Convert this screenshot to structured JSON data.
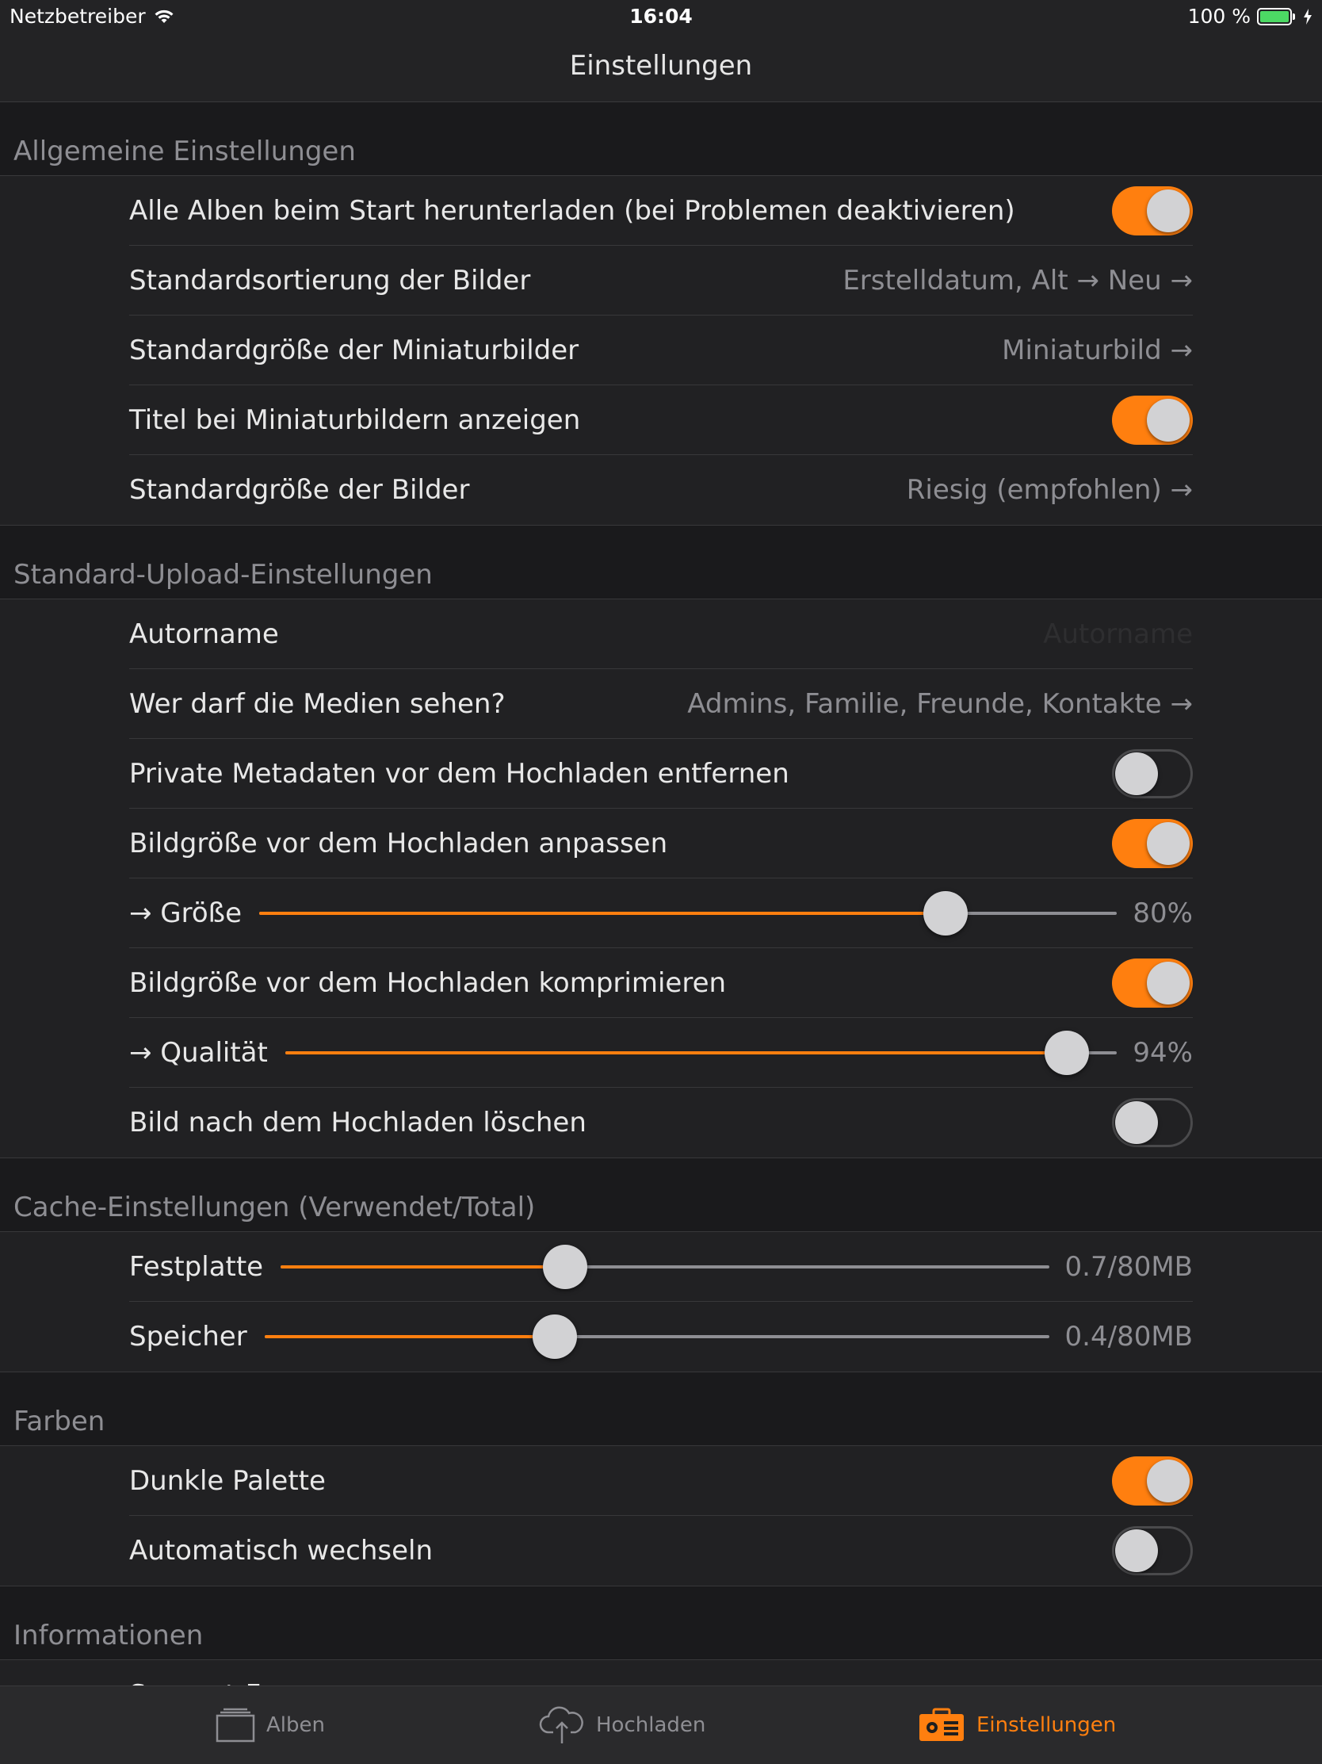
{
  "status_bar": {
    "carrier": "Netzbetreiber",
    "time": "16:04",
    "battery": "100 %"
  },
  "nav": {
    "title": "Einstellungen"
  },
  "sections": {
    "general": {
      "header": "Allgemeine Einstellungen",
      "download_all": {
        "label": "Alle Alben beim Start herunterladen (bei Problemen deaktivieren)",
        "on": true
      },
      "sort": {
        "label": "Standardsortierung der Bilder",
        "value": "Erstelldatum, Alt → Neu →"
      },
      "thumb_size": {
        "label": "Standardgröße der Miniaturbilder",
        "value": "Miniaturbild →"
      },
      "show_titles": {
        "label": "Titel bei Miniaturbildern anzeigen",
        "on": true
      },
      "image_size": {
        "label": "Standardgröße der Bilder",
        "value": "Riesig (empfohlen) →"
      }
    },
    "upload": {
      "header": "Standard-Upload-Einstellungen",
      "author": {
        "label": "Autorname",
        "placeholder": "Autorname"
      },
      "privacy": {
        "label": "Wer darf die Medien sehen?",
        "value": "Admins, Familie, Freunde, Kontakte →"
      },
      "strip_metadata": {
        "label": "Private Metadaten vor dem Hochladen entfernen",
        "on": false
      },
      "resize": {
        "label": "Bildgröße vor dem Hochladen anpassen",
        "on": true
      },
      "size_slider": {
        "label": "→ Größe",
        "value_text": "80%",
        "fraction": 0.8
      },
      "compress": {
        "label": "Bildgröße vor dem Hochladen komprimieren",
        "on": true
      },
      "quality_slider": {
        "label": "→ Qualität",
        "value_text": "94%",
        "fraction": 0.94
      },
      "delete_after": {
        "label": "Bild nach dem Hochladen löschen",
        "on": false
      }
    },
    "cache": {
      "header": "Cache-Einstellungen (Verwendet/Total)",
      "disk": {
        "label": "Festplatte",
        "value_text": "0.7/80MB",
        "fraction": 0.37
      },
      "memory": {
        "label": "Speicher",
        "value_text": "0.4/80MB",
        "fraction": 0.37
      }
    },
    "colors": {
      "header": "Farben",
      "dark_palette": {
        "label": "Dunkle Palette",
        "on": true
      },
      "auto_switch": {
        "label": "Automatisch wechseln",
        "on": false
      }
    },
    "info": {
      "header": "Informationen",
      "forum": {
        "label": "Support-Forum",
        "value": "→"
      }
    }
  },
  "tabs": {
    "albums": "Alben",
    "upload": "Hochladen",
    "settings": "Einstellungen"
  },
  "colors": {
    "accent": "#ff7f0f",
    "background": "#1a1a1c",
    "cell": "#212123"
  }
}
